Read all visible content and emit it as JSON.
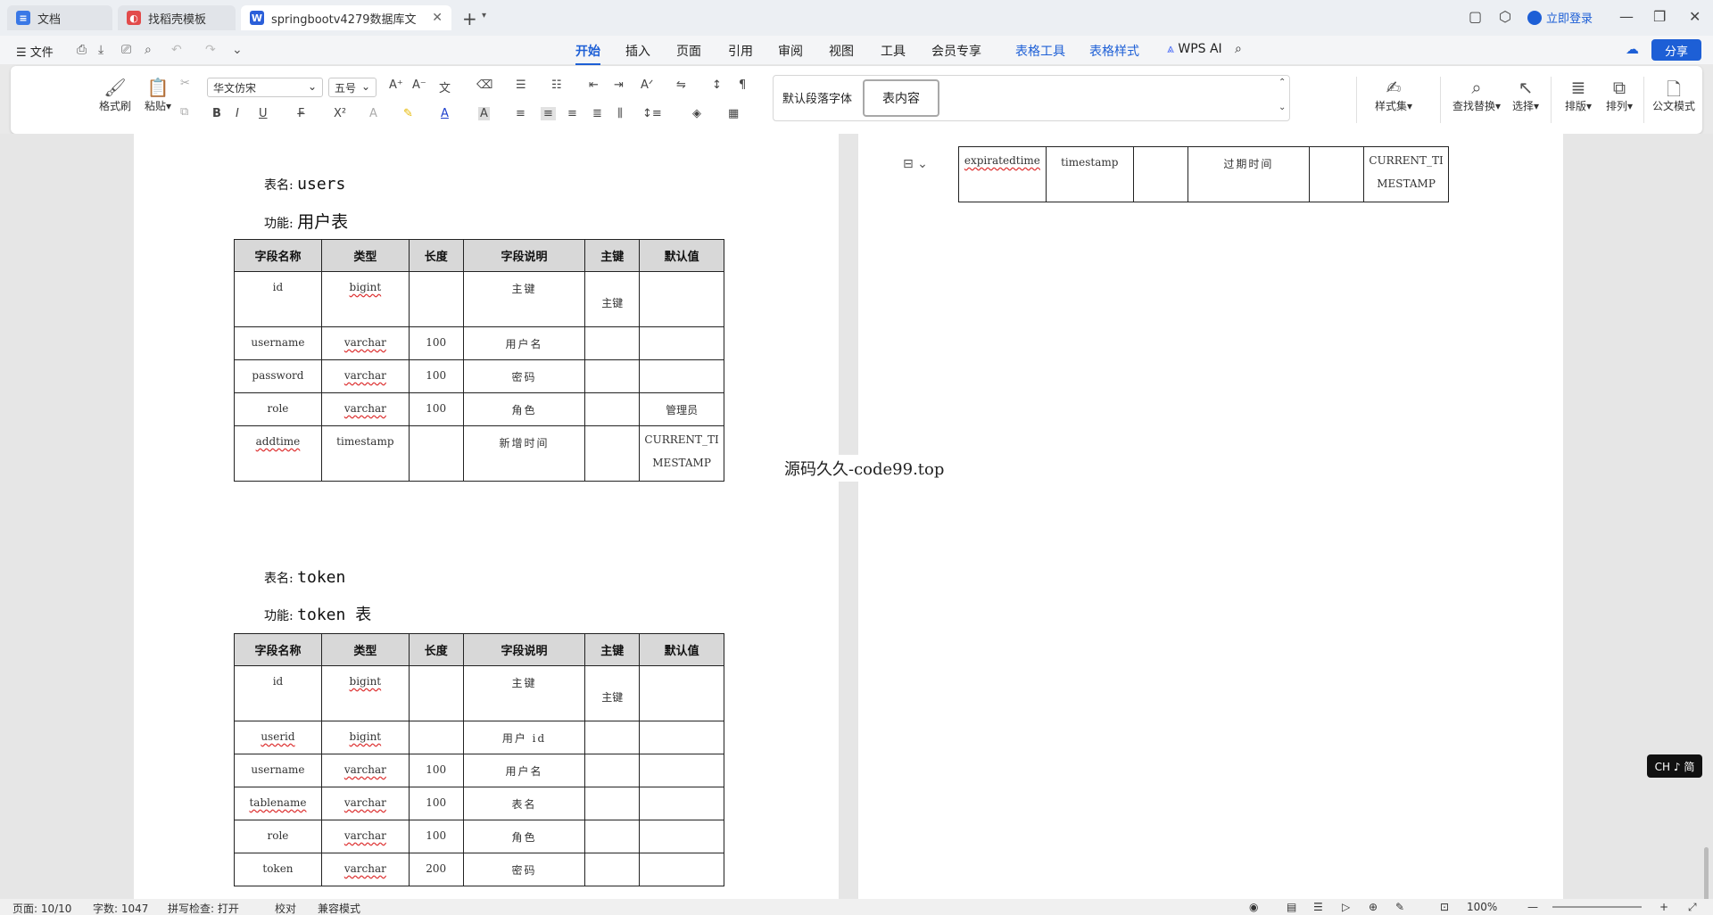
{
  "tabs": [
    {
      "label": "文档",
      "color": "#3a78e6"
    },
    {
      "label": "找稻壳模板",
      "color": "#e24b4b"
    },
    {
      "label": "springbootv4279数据库文",
      "color": "#2b5fd9",
      "icon": "W"
    }
  ],
  "titlebar": {
    "login": "立即登录"
  },
  "menu": {
    "file": "文件",
    "tabs": [
      "开始",
      "插入",
      "页面",
      "引用",
      "审阅",
      "视图",
      "工具",
      "会员专享",
      "表格工具",
      "表格样式"
    ],
    "wps_ai": "WPS AI",
    "share": "分享"
  },
  "ribbon": {
    "format_painter": "格式刷",
    "paste": "粘贴",
    "font_name": "华文仿宋",
    "font_size": "五号",
    "style_default": "默认段落字体",
    "style_selected": "表内容",
    "styles": "样式集",
    "find_replace": "查找替换",
    "select": "选择",
    "layout": "排版",
    "arrange": "排列",
    "official": "公文模式"
  },
  "doc": {
    "label_table": "表名:",
    "label_func": "功能:",
    "headers": [
      "字段名称",
      "类型",
      "长度",
      "字段说明",
      "主键",
      "默认值"
    ],
    "users": {
      "name": "users",
      "func": "用户表",
      "rows": [
        [
          "id",
          "bigint",
          "",
          "主键",
          "主键",
          ""
        ],
        [
          "username",
          "varchar",
          "100",
          "用户名",
          "",
          ""
        ],
        [
          "password",
          "varchar",
          "100",
          "密码",
          "",
          ""
        ],
        [
          "role",
          "varchar",
          "100",
          "角色",
          "",
          "管理员"
        ],
        [
          "addtime",
          "timestamp",
          "",
          "新增时间",
          "",
          "CURRENT_TIMESTAMP"
        ]
      ]
    },
    "token": {
      "name": "token",
      "func": "token 表",
      "rows": [
        [
          "id",
          "bigint",
          "",
          "主键",
          "主键",
          ""
        ],
        [
          "userid",
          "bigint",
          "",
          "用户 id",
          "",
          ""
        ],
        [
          "username",
          "varchar",
          "100",
          "用户名",
          "",
          ""
        ],
        [
          "tablename",
          "varchar",
          "100",
          "表名",
          "",
          ""
        ],
        [
          "role",
          "varchar",
          "100",
          "角色",
          "",
          ""
        ],
        [
          "token",
          "varchar",
          "200",
          "密码",
          "",
          ""
        ]
      ],
      "continued_row": [
        "expiratedtime",
        "timestamp",
        "",
        "过期时间",
        "",
        "CURRENT_TIMESTAMP"
      ]
    },
    "watermark": "源码久久-code99.top"
  },
  "ime": "CH ♪ 简",
  "status": {
    "page": "页面: 10/10",
    "words": "字数: 1047",
    "spell": "拼写检查: 打开",
    "proof": "校对",
    "compat": "兼容模式",
    "zoom": "100%"
  }
}
